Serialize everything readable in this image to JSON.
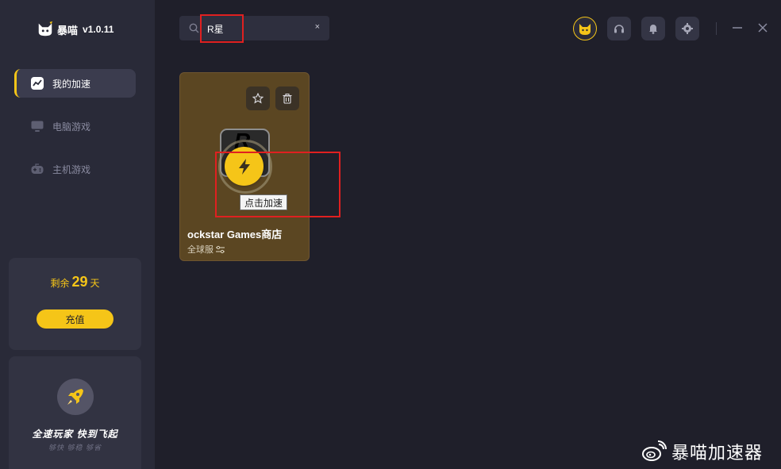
{
  "app": {
    "name": "暴喵",
    "version": "v1.0.11"
  },
  "sidebar": {
    "items": [
      {
        "label": "我的加速",
        "icon": "chart-icon",
        "active": true
      },
      {
        "label": "电脑游戏",
        "icon": "monitor-icon",
        "active": false
      },
      {
        "label": "主机游戏",
        "icon": "gamepad-icon",
        "active": false
      }
    ],
    "vip": {
      "prefix": "剩余",
      "days": "29",
      "suffix": "天",
      "recharge_label": "充值"
    },
    "promo": {
      "title": "全速玩家  快到飞起",
      "subtitle": "够快  够稳  够省"
    }
  },
  "search": {
    "value": "R星",
    "clear_label": "×"
  },
  "header": {
    "icons": [
      "avatar-icon",
      "headset-icon",
      "bell-icon",
      "gear-icon"
    ],
    "window": [
      "minimize-icon",
      "close-icon"
    ]
  },
  "game_card": {
    "icon_letter": "R",
    "title": "ockstar Games商店",
    "region": "全球服",
    "tooltip": "点击加速"
  },
  "watermark": {
    "text": "暴喵加速器"
  },
  "colors": {
    "accent": "#f5c518",
    "sidebar_bg": "#292a38",
    "main_bg": "#1f1f2a",
    "card_bg": "#5b4622",
    "highlight_box": "#e02020"
  }
}
